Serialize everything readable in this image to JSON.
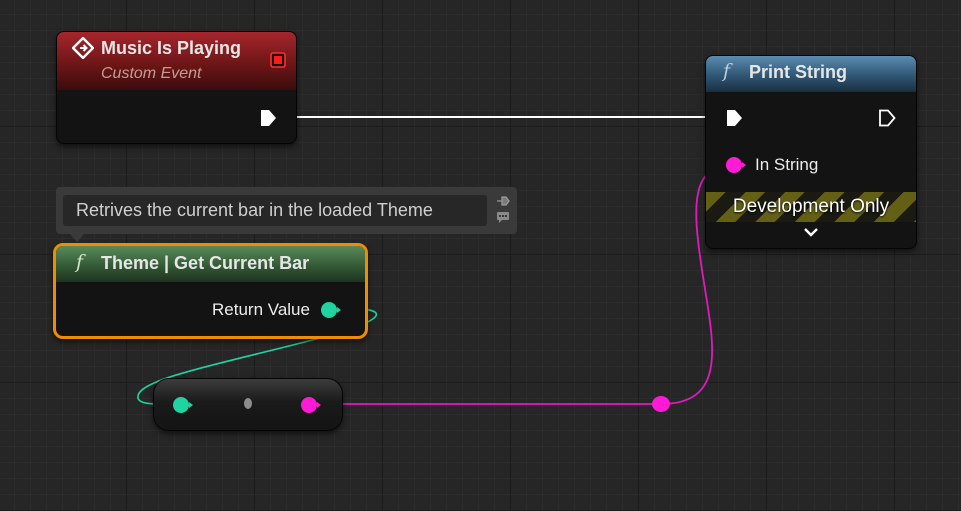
{
  "nodes": {
    "custom_event": {
      "title": "Music Is Playing",
      "subtitle": "Custom Event"
    },
    "print_string": {
      "function_glyph": "f",
      "title": "Print String",
      "in_string_label": "In String",
      "development_label": "Development Only"
    },
    "get_current_bar": {
      "function_glyph": "f",
      "title": "Theme | Get Current Bar",
      "return_value_label": "Return Value"
    }
  },
  "comment": {
    "text": "Retrives the current bar in the loaded Theme"
  },
  "colors": {
    "event_header": "#a5262c",
    "function_header_print": "#5c8bb0",
    "function_header_theme": "#5a8a5b",
    "selection_outline": "#f08c00",
    "exec_wire": "#ffffff",
    "integer_pin": "#1ed4a0",
    "string_pin": "#ff1ad6",
    "dev_stripe": "#636016"
  },
  "icons": {
    "event": "event-diamond-icon",
    "delegate": "delegate-square-icon",
    "exec": "exec-pin-icon",
    "function": "function-f-icon",
    "chevron": "chevron-down-icon",
    "pin_comment": "pin-icon",
    "comment_box": "comment-box-icon"
  }
}
